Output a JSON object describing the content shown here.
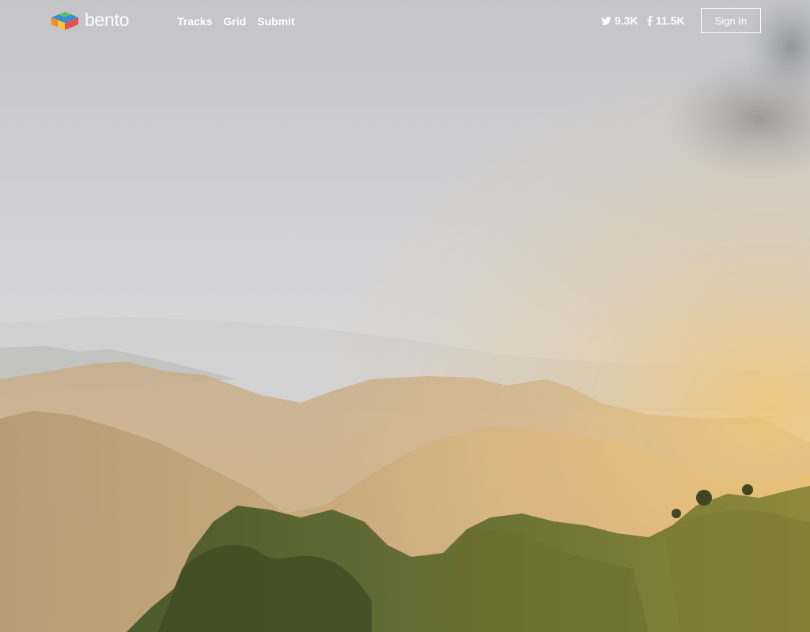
{
  "brand": {
    "name": "bento",
    "logo_icon": "bento-box-icon"
  },
  "nav": {
    "links": [
      {
        "label": "Tracks"
      },
      {
        "label": "Grid"
      },
      {
        "label": "Submit"
      }
    ]
  },
  "social": {
    "twitter": {
      "icon": "twitter-bird-icon",
      "count": "9.3K"
    },
    "facebook": {
      "icon": "facebook-f-icon",
      "count": "11.5K"
    }
  },
  "auth": {
    "signin_label": "Sign In"
  },
  "colors": {
    "sky": "#c9c9cb",
    "haze": "#dcdcdc",
    "sun_glow": "#e7c48a",
    "mountain_far": "#c7a981",
    "mountain_mid": "#b89d72",
    "ridge_green": "#5d6a33",
    "ridge_light": "#9c8f3d",
    "logo_green": "#5cc35a",
    "logo_blue": "#3a8ed8",
    "logo_orange": "#f08a2b",
    "logo_red": "#e45151",
    "logo_yellow": "#f3c93a"
  }
}
